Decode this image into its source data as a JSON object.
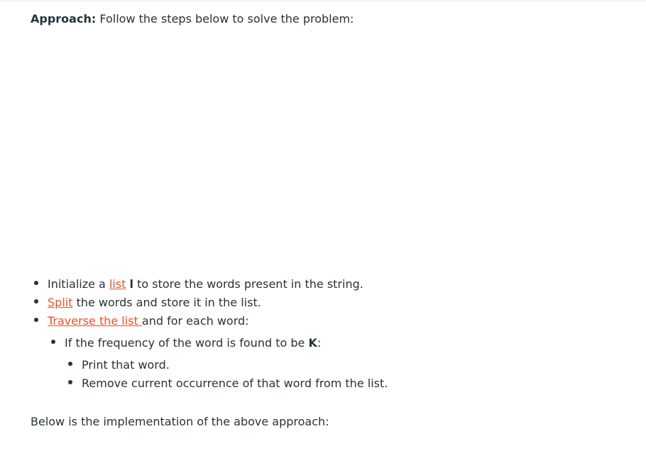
{
  "intro": {
    "label": "Approach:",
    "text": " Follow the steps below to solve the problem:"
  },
  "steps": [
    {
      "pre": "Initialize a ",
      "link": "list",
      "bold": "l",
      "post": " to store the words present in the string."
    },
    {
      "pre": "",
      "link": "Split",
      "bold": "",
      "post": " the words and store it in the list."
    },
    {
      "pre": "",
      "link": "Traverse the list ",
      "bold": "",
      "post": "and for each word:"
    }
  ],
  "sub": {
    "pre": "If the frequency of the word is found to be ",
    "bold": "K",
    "post": ":"
  },
  "subsub": [
    {
      "text": "Print that word."
    },
    {
      "text": "Remove current occurrence of that word from the list."
    }
  ],
  "outro": "Below is the implementation of the above approach:",
  "colors": {
    "link": "#e2542b",
    "text": "#273239"
  }
}
